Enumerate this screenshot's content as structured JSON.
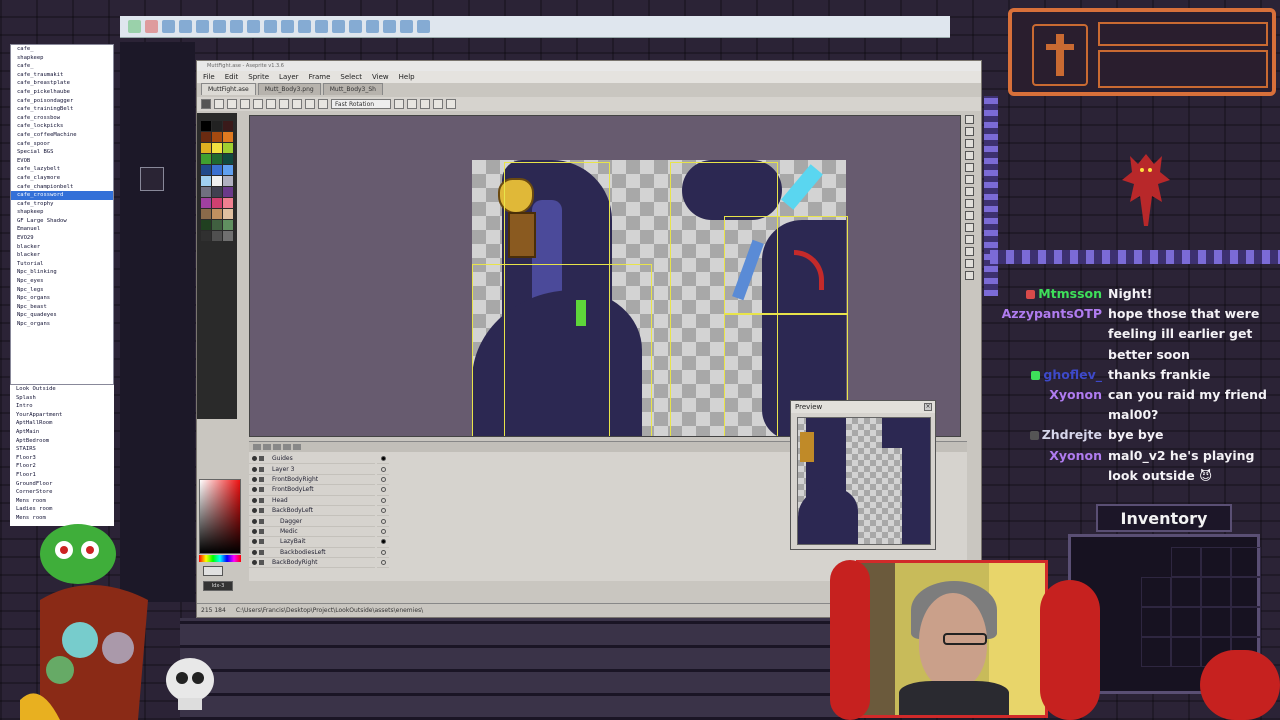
{
  "aseprite": {
    "title": "MuttFight.ase - Aseprite v1.3.6",
    "menu": [
      "File",
      "Edit",
      "Sprite",
      "Layer",
      "Frame",
      "Select",
      "View",
      "Help"
    ],
    "tabs": [
      "MuttFight.ase",
      "Mutt_Body3.png",
      "Mutt_Body3_Sh"
    ],
    "toolbar_select": "Fast Rotation",
    "layers": [
      "Guides",
      "Layer 3",
      "FrontBodyRight",
      "FrontBodyLeft",
      "Head",
      "BackBodyLeft",
      "Dagger",
      "Medic",
      "LazyBait",
      "BackbodiesLeft",
      "BackBodyRight"
    ],
    "status": {
      "coords": "215 184",
      "path": "C:\\Users\\Francis\\Desktop\\Project\\LookOutside\\assets\\enemies\\"
    },
    "preview_title": "Preview",
    "color_value": "Idx-3"
  },
  "file_tree": {
    "items": [
      "cafe_",
      "shapkeep",
      "cafe_",
      "cafe_traumakit",
      "cafe_breastplate",
      "cafe_pickelhaube",
      "cafe_poisondagger",
      "cafe_trainingBelt",
      "cafe_crossbow",
      "cafe_lockpicks",
      "cafe_coffeeMachine",
      "cafe_spoor",
      "Special BGS",
      "EVOB",
      "cafe_lazybelt",
      "cafe_claymore",
      "cafe_championbelt",
      "cafe_crossword",
      "cafe_trophy",
      "shapkeep",
      "GF Large Shadow",
      "Emanuel",
      "EVO29",
      "blacker",
      "blacker",
      "Tutorial",
      "Npc_blinking",
      "Npc_eyes",
      "Npc_legs",
      "Npc_organs",
      "Npc_beast",
      "Npc_quadeyes",
      "Npc_organs"
    ],
    "selected_index": 17,
    "items2": [
      "Look Outside",
      "Splash",
      "Intro",
      "YourAppartment",
      "AptHallRoom",
      "AptMain",
      "AptBedroom",
      "STAIRS",
      "Floor3",
      "Floor2",
      "Floor1",
      "GroundFloor",
      "CornerStore",
      "Mens room",
      "Ladies room",
      "Mens room"
    ]
  },
  "chat": [
    {
      "name": "Mtmsson",
      "color": "#3ee05a",
      "message": "Night!",
      "badge": "#d84a4a"
    },
    {
      "name": "AzzypantsOTP",
      "color": "#b07cf0",
      "message": "hope those that were feeling ill earlier get better soon",
      "badge": ""
    },
    {
      "name": "ghoflev_",
      "color": "#3d49c9",
      "message": "thanks frankie",
      "badge": "#3ee05a"
    },
    {
      "name": "Xyonon",
      "color": "#b07cf0",
      "message": "can you raid my friend mal00?",
      "badge": ""
    },
    {
      "name": "Zhdrejte",
      "color": "#d6d6ea",
      "message": "bye bye",
      "badge": "#555"
    },
    {
      "name": "Xyonon",
      "color": "#b07cf0",
      "message": "mal0_v2 he's playing look outside 😈",
      "badge": ""
    }
  ],
  "inventory": {
    "title": "Inventory"
  },
  "colors": {
    "accent_orange": "#d8703a",
    "tentacle_red": "#c6211f",
    "slice_yellow": "#e8e44a"
  }
}
